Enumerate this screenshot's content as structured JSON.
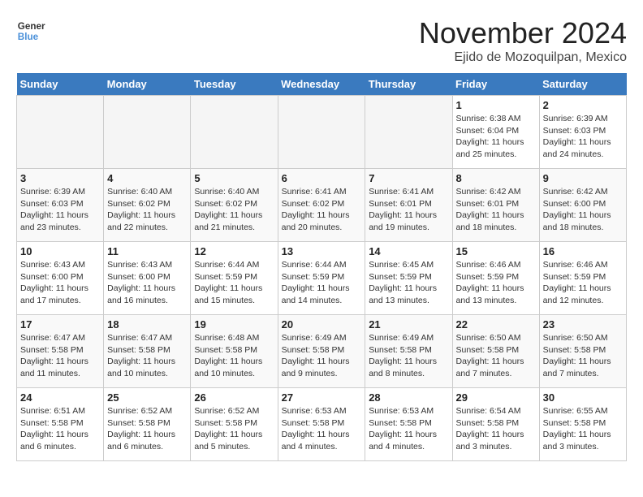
{
  "logo": {
    "line1": "General",
    "line2": "Blue"
  },
  "title": "November 2024",
  "location": "Ejido de Mozoquilpan, Mexico",
  "days_header": [
    "Sunday",
    "Monday",
    "Tuesday",
    "Wednesday",
    "Thursday",
    "Friday",
    "Saturday"
  ],
  "weeks": [
    [
      {
        "day": "",
        "detail": ""
      },
      {
        "day": "",
        "detail": ""
      },
      {
        "day": "",
        "detail": ""
      },
      {
        "day": "",
        "detail": ""
      },
      {
        "day": "",
        "detail": ""
      },
      {
        "day": "1",
        "detail": "Sunrise: 6:38 AM\nSunset: 6:04 PM\nDaylight: 11 hours\nand 25 minutes."
      },
      {
        "day": "2",
        "detail": "Sunrise: 6:39 AM\nSunset: 6:03 PM\nDaylight: 11 hours\nand 24 minutes."
      }
    ],
    [
      {
        "day": "3",
        "detail": "Sunrise: 6:39 AM\nSunset: 6:03 PM\nDaylight: 11 hours\nand 23 minutes."
      },
      {
        "day": "4",
        "detail": "Sunrise: 6:40 AM\nSunset: 6:02 PM\nDaylight: 11 hours\nand 22 minutes."
      },
      {
        "day": "5",
        "detail": "Sunrise: 6:40 AM\nSunset: 6:02 PM\nDaylight: 11 hours\nand 21 minutes."
      },
      {
        "day": "6",
        "detail": "Sunrise: 6:41 AM\nSunset: 6:02 PM\nDaylight: 11 hours\nand 20 minutes."
      },
      {
        "day": "7",
        "detail": "Sunrise: 6:41 AM\nSunset: 6:01 PM\nDaylight: 11 hours\nand 19 minutes."
      },
      {
        "day": "8",
        "detail": "Sunrise: 6:42 AM\nSunset: 6:01 PM\nDaylight: 11 hours\nand 18 minutes."
      },
      {
        "day": "9",
        "detail": "Sunrise: 6:42 AM\nSunset: 6:00 PM\nDaylight: 11 hours\nand 18 minutes."
      }
    ],
    [
      {
        "day": "10",
        "detail": "Sunrise: 6:43 AM\nSunset: 6:00 PM\nDaylight: 11 hours\nand 17 minutes."
      },
      {
        "day": "11",
        "detail": "Sunrise: 6:43 AM\nSunset: 6:00 PM\nDaylight: 11 hours\nand 16 minutes."
      },
      {
        "day": "12",
        "detail": "Sunrise: 6:44 AM\nSunset: 5:59 PM\nDaylight: 11 hours\nand 15 minutes."
      },
      {
        "day": "13",
        "detail": "Sunrise: 6:44 AM\nSunset: 5:59 PM\nDaylight: 11 hours\nand 14 minutes."
      },
      {
        "day": "14",
        "detail": "Sunrise: 6:45 AM\nSunset: 5:59 PM\nDaylight: 11 hours\nand 13 minutes."
      },
      {
        "day": "15",
        "detail": "Sunrise: 6:46 AM\nSunset: 5:59 PM\nDaylight: 11 hours\nand 13 minutes."
      },
      {
        "day": "16",
        "detail": "Sunrise: 6:46 AM\nSunset: 5:59 PM\nDaylight: 11 hours\nand 12 minutes."
      }
    ],
    [
      {
        "day": "17",
        "detail": "Sunrise: 6:47 AM\nSunset: 5:58 PM\nDaylight: 11 hours\nand 11 minutes."
      },
      {
        "day": "18",
        "detail": "Sunrise: 6:47 AM\nSunset: 5:58 PM\nDaylight: 11 hours\nand 10 minutes."
      },
      {
        "day": "19",
        "detail": "Sunrise: 6:48 AM\nSunset: 5:58 PM\nDaylight: 11 hours\nand 10 minutes."
      },
      {
        "day": "20",
        "detail": "Sunrise: 6:49 AM\nSunset: 5:58 PM\nDaylight: 11 hours\nand 9 minutes."
      },
      {
        "day": "21",
        "detail": "Sunrise: 6:49 AM\nSunset: 5:58 PM\nDaylight: 11 hours\nand 8 minutes."
      },
      {
        "day": "22",
        "detail": "Sunrise: 6:50 AM\nSunset: 5:58 PM\nDaylight: 11 hours\nand 7 minutes."
      },
      {
        "day": "23",
        "detail": "Sunrise: 6:50 AM\nSunset: 5:58 PM\nDaylight: 11 hours\nand 7 minutes."
      }
    ],
    [
      {
        "day": "24",
        "detail": "Sunrise: 6:51 AM\nSunset: 5:58 PM\nDaylight: 11 hours\nand 6 minutes."
      },
      {
        "day": "25",
        "detail": "Sunrise: 6:52 AM\nSunset: 5:58 PM\nDaylight: 11 hours\nand 6 minutes."
      },
      {
        "day": "26",
        "detail": "Sunrise: 6:52 AM\nSunset: 5:58 PM\nDaylight: 11 hours\nand 5 minutes."
      },
      {
        "day": "27",
        "detail": "Sunrise: 6:53 AM\nSunset: 5:58 PM\nDaylight: 11 hours\nand 4 minutes."
      },
      {
        "day": "28",
        "detail": "Sunrise: 6:53 AM\nSunset: 5:58 PM\nDaylight: 11 hours\nand 4 minutes."
      },
      {
        "day": "29",
        "detail": "Sunrise: 6:54 AM\nSunset: 5:58 PM\nDaylight: 11 hours\nand 3 minutes."
      },
      {
        "day": "30",
        "detail": "Sunrise: 6:55 AM\nSunset: 5:58 PM\nDaylight: 11 hours\nand 3 minutes."
      }
    ]
  ]
}
